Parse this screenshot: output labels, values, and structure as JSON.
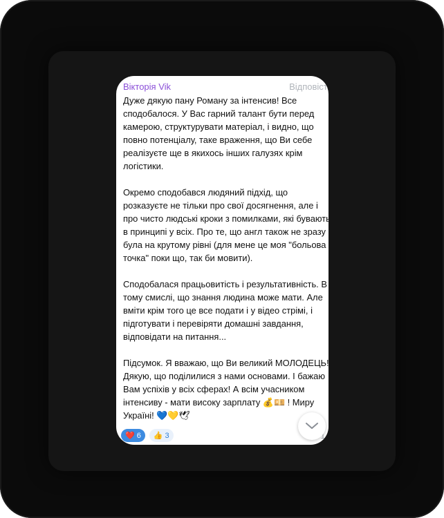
{
  "message": {
    "author": "Вікторія Vik",
    "reply_label": "Відповісти",
    "text": "Дуже дякую пану Роману за інтенсив! Все сподобалося. У Вас гарний талант бути перед камерою, структурувати матеріал, і видно, що повно потенціалу, таке враження, що Ви себе реалізуєте ще в якихось інших галузях крім логістики.\n\nОкремо сподобався людяний підхід, що розказуєте не тільки про свої досягнення, але і про чисто людські кроки з помилками, які бувають в принципі у всіх. Про те, що англ також не зразу була на крутому рівні (для мене це моя \"больова точка\" поки що, так би мовити).\n\nСподобалася працьовитість і результативність. В тому смислі, що знання людина може мати. Але вміти крім того це все подати і у відео стрімі, і підготувати і перевіряти домашні завдання, відповідати на питання...\n\nПідсумок. Я вважаю, що Ви великий МОЛОДЕЦЬ! Дякую, що поділилися з нами основами. І бажаю Вам успіхів у всіх сферах! А всім учасником інтенсиву - мати високу зарплату 💰💴 ! Миру Україні! 💙💛🕊",
    "reactions": [
      {
        "emoji": "❤️",
        "count": "6"
      },
      {
        "emoji": "👍",
        "count": "3"
      }
    ],
    "meta": "↩ 1  2"
  },
  "colors": {
    "author": "#8b4fd8",
    "reaction_active": "#3d8be0",
    "reaction": "#e9f1fb"
  },
  "icons": {
    "scroll_down": "chevron-down-icon",
    "reply": "reply-arrow-icon"
  }
}
